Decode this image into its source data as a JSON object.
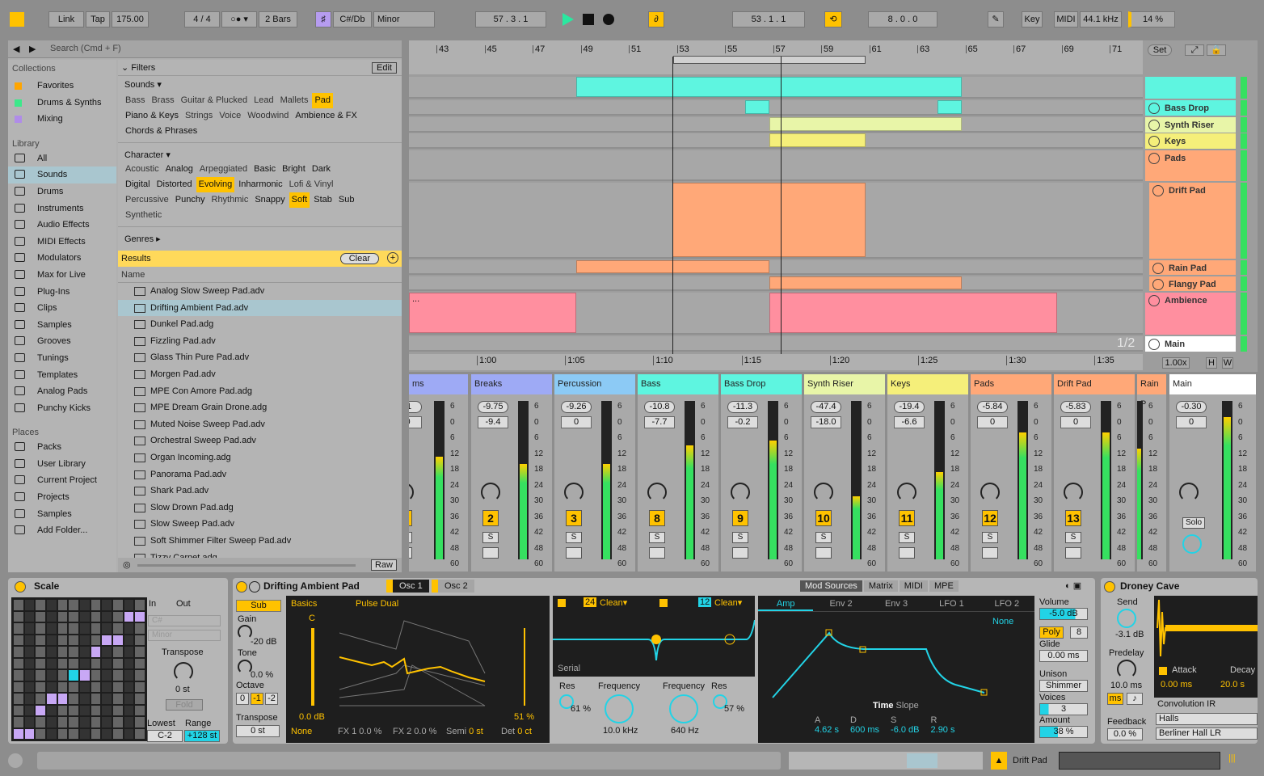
{
  "transport": {
    "link": "Link",
    "tap": "Tap",
    "tempo": "175.00",
    "signature": "4 / 4",
    "quantize": "2 Bars",
    "key": "C#/Db",
    "scale": "Minor",
    "position": "57 .   3 .   1",
    "loop_start": "53 .   1 .   1",
    "loop_length": "8 .   0 .   0",
    "key_map": "Key",
    "midi_map": "MIDI",
    "sample_rate": "44.1 kHz",
    "cpu": "14 %"
  },
  "browser": {
    "search_placeholder": "Search (Cmd + F)",
    "collections_title": "Collections",
    "collections": [
      {
        "label": "Favorites",
        "color": "#ffa500"
      },
      {
        "label": "Drums & Synths",
        "color": "#3ce88a"
      },
      {
        "label": "Mixing",
        "color": "#b08ce8"
      }
    ],
    "library_title": "Library",
    "library": [
      "All",
      "Sounds",
      "Drums",
      "Instruments",
      "Audio Effects",
      "MIDI Effects",
      "Modulators",
      "Max for Live",
      "Plug-Ins",
      "Clips",
      "Samples",
      "Grooves",
      "Tunings",
      "Templates",
      "Analog Pads",
      "Punchy Kicks"
    ],
    "selected_library": "Sounds",
    "places_title": "Places",
    "places": [
      "Packs",
      "User Library",
      "Current Project",
      "Projects",
      "Samples",
      "Add Folder..."
    ],
    "filters_label": "Filters",
    "edit_label": "Edit",
    "sounds_label": "Sounds ▾",
    "sounds_tags": [
      [
        "Bass",
        "Brass",
        "Guitar & Plucked",
        "Lead",
        "Mallets",
        "Pad"
      ],
      [
        "Piano & Keys",
        "Strings",
        "Voice",
        "Woodwind",
        "Ambience & FX"
      ],
      [
        "Chords & Phrases"
      ]
    ],
    "sounds_active": [
      "Pad"
    ],
    "sounds_boxed": [
      "Piano & Keys",
      "Ambience & FX",
      "Chords & Phrases"
    ],
    "character_label": "Character ▾",
    "character_tags": [
      [
        "Acoustic",
        "Analog",
        "Arpeggiated",
        "Basic",
        "Bright",
        "Dark"
      ],
      [
        "Digital",
        "Distorted",
        "Evolving",
        "Inharmonic",
        "Lofi & Vinyl"
      ],
      [
        "Percussive",
        "Punchy",
        "Rhythmic",
        "Snappy",
        "Soft",
        "Stab",
        "Sub"
      ],
      [
        "Synthetic"
      ]
    ],
    "character_active": [
      "Evolving",
      "Soft"
    ],
    "character_boxed": [
      "Analog",
      "Basic",
      "Bright",
      "Dark",
      "Digital",
      "Distorted",
      "Inharmonic",
      "Punchy",
      "Snappy",
      "Stab",
      "Sub"
    ],
    "genres_label": "Genres ▸",
    "results_label": "Results",
    "clear_label": "Clear",
    "name_header": "Name",
    "results": [
      "Analog Slow Sweep Pad.adv",
      "Drifting Ambient Pad.adv",
      "Dunkel Pad.adg",
      "Fizzling Pad.adv",
      "Glass Thin Pure Pad.adv",
      "Morgen Pad.adv",
      "MPE Con Amore Pad.adg",
      "MPE Dream Grain Drone.adg",
      "Muted Noise Sweep Pad.adv",
      "Orchestral Sweep Pad.adv",
      "Organ Incoming.adg",
      "Panorama Pad.adv",
      "Shark Pad.adv",
      "Slow Drown Pad.adg",
      "Slow Sweep Pad.adv",
      "Soft Shimmer Filter Sweep Pad.adv",
      "Tizzy Carpet.adg"
    ],
    "selected_result": "Drifting Ambient Pad.adv",
    "raw_label": "Raw"
  },
  "arrangement": {
    "bars": [
      "43",
      "45",
      "47",
      "49",
      "51",
      "53",
      "55",
      "57",
      "59",
      "61",
      "63",
      "65",
      "67",
      "69",
      "71"
    ],
    "times": [
      "1:00",
      "1:05",
      "1:10",
      "1:15",
      "1:20",
      "1:25",
      "1:30",
      "1:35"
    ],
    "set_label": "Set",
    "page": "1/2",
    "zoom": "1.00x",
    "h_label": "H",
    "w_label": "W",
    "clip_dots": "...",
    "tracks": [
      {
        "name": "",
        "color": "#5ef5e0"
      },
      {
        "name": "Bass Drop",
        "color": "#5ef5e0"
      },
      {
        "name": "Synth Riser",
        "color": "#e8f5a8"
      },
      {
        "name": "Keys",
        "color": "#f5ef7a"
      },
      {
        "name": "Pads",
        "color": "#ffa878"
      },
      {
        "name": "Drift Pad",
        "color": "#ffa878"
      },
      {
        "name": "Rain Pad",
        "color": "#ffa878"
      },
      {
        "name": "Flangy Pad",
        "color": "#ffa878"
      },
      {
        "name": "Ambience",
        "color": "#ff8f9f"
      },
      {
        "name": "Main",
        "color": "#ffffff"
      }
    ]
  },
  "mixer": {
    "meter_scale": [
      "6",
      "0",
      "6",
      "12",
      "18",
      "24",
      "30",
      "36",
      "42",
      "48",
      "60"
    ],
    "solo_label": "Solo",
    "s_label": "S",
    "strips": [
      {
        "name": "ms",
        "color": "#9eaaf5",
        "peak": "31",
        "volume": ".0",
        "number": "1"
      },
      {
        "name": "Breaks",
        "color": "#9eaaf5",
        "peak": "-9.75",
        "volume": "-9.4",
        "number": "2"
      },
      {
        "name": "Percussion",
        "color": "#8ccaf5",
        "peak": "-9.26",
        "volume": "0",
        "number": "3"
      },
      {
        "name": "Bass",
        "color": "#5ef5e0",
        "peak": "-10.8",
        "volume": "-7.7",
        "number": "8"
      },
      {
        "name": "Bass Drop",
        "color": "#5ef5e0",
        "peak": "-11.3",
        "volume": "-0.2",
        "number": "9"
      },
      {
        "name": "Synth Riser",
        "color": "#e8f5a8",
        "peak": "-47.4",
        "volume": "-18.0",
        "number": "10"
      },
      {
        "name": "Keys",
        "color": "#f5ef7a",
        "peak": "-19.4",
        "volume": "-6.6",
        "number": "11"
      },
      {
        "name": "Pads",
        "color": "#ffa878",
        "peak": "-5.84",
        "volume": "0",
        "number": "12"
      },
      {
        "name": "Drift Pad",
        "color": "#ffa878",
        "peak": "-5.83",
        "volume": "0",
        "number": "13"
      },
      {
        "name": "Rain P",
        "color": "#ffa878",
        "peak": "-13.",
        "volume": "0",
        "number": "14"
      },
      {
        "name": "Main",
        "color": "#ffffff",
        "peak": "-0.30",
        "volume": "0",
        "number": ""
      }
    ]
  },
  "scale_device": {
    "title": "Scale",
    "in": "In",
    "out": "Out",
    "root": "C#",
    "mode": "Minor",
    "transpose_label": "Transpose",
    "transpose": "0 st",
    "fold": "Fold",
    "lowest_label": "Lowest",
    "range_label": "Range",
    "lowest": "C-2",
    "range": "+128 st"
  },
  "drift": {
    "title": "Drifting Ambient Pad",
    "tabs": [
      "Osc 1",
      "Osc 2"
    ],
    "sub": "Sub",
    "gain_label": "Gain",
    "gain": "-20 dB",
    "tone_label": "Tone",
    "tone": "0.0 %",
    "octave_label": "Octave",
    "octaves": [
      "0",
      "-1",
      "-2"
    ],
    "transpose_label": "Transpose",
    "transpose": "0 st",
    "osc_category": "Basics",
    "osc_wave": "Pulse Dual",
    "pitch_note": "C",
    "osc_level": "0.0 dB",
    "osc_shape": "51 %",
    "mod_none": "None",
    "fx1": "FX 1 0.0 %",
    "fx2": "FX 2 0.0 %",
    "semi_label": "Semi",
    "semi": "0 st",
    "det_label": "Det",
    "det": "0 ct",
    "filter1_slope": "24",
    "filter1_type": "Clean▾",
    "filter2_slope": "12",
    "filter2_type": "Clean▾",
    "routing": "Serial",
    "res1_label": "Res",
    "res1": "61 %",
    "freq1_label": "Frequency",
    "freq1": "10.0 kHz",
    "freq2_label": "Frequency",
    "freq2": "640 Hz",
    "res2_label": "Res",
    "res2": "57 %",
    "mod_tabs": [
      "Mod Sources",
      "Matrix",
      "MIDI",
      "MPE"
    ],
    "env_tabs": [
      "Amp",
      "Env 2",
      "Env 3",
      "LFO 1",
      "LFO 2"
    ],
    "env_mod": "None",
    "time_label": "Time",
    "slope_label": "Slope",
    "adsr_labels": [
      "A",
      "D",
      "S",
      "R"
    ],
    "adsr": [
      "4.62 s",
      "600 ms",
      "-6.0 dB",
      "2.90 s"
    ],
    "volume_label": "Volume",
    "volume": "-5.0 dB",
    "poly": "Poly",
    "voices_count": "8",
    "glide_label": "Glide",
    "glide": "0.00 ms",
    "unison_label": "Unison",
    "unison": "Shimmer",
    "voices_label": "Voices",
    "voices": "3",
    "amount_label": "Amount",
    "amount": "38 %"
  },
  "reverb": {
    "title": "Droney Cave",
    "send_label": "Send",
    "send": "-3.1 dB",
    "predelay_label": "Predelay",
    "predelay": "10.0 ms",
    "ms": "ms",
    "note": "♪",
    "feedback_label": "Feedback",
    "feedback": "0.0 %",
    "attack_label": "Attack",
    "attack": "0.00 ms",
    "decay_label": "Decay",
    "decay": "20.0 s",
    "ir_label": "Convolution IR",
    "ir_category": "Halls",
    "ir_file": "Berliner Hall LR"
  },
  "status": {
    "selected_track": "Drift Pad"
  },
  "colors": {
    "accent": "#ffc200",
    "cyan": "#22d3e6",
    "selection": "#a9c6cf"
  }
}
